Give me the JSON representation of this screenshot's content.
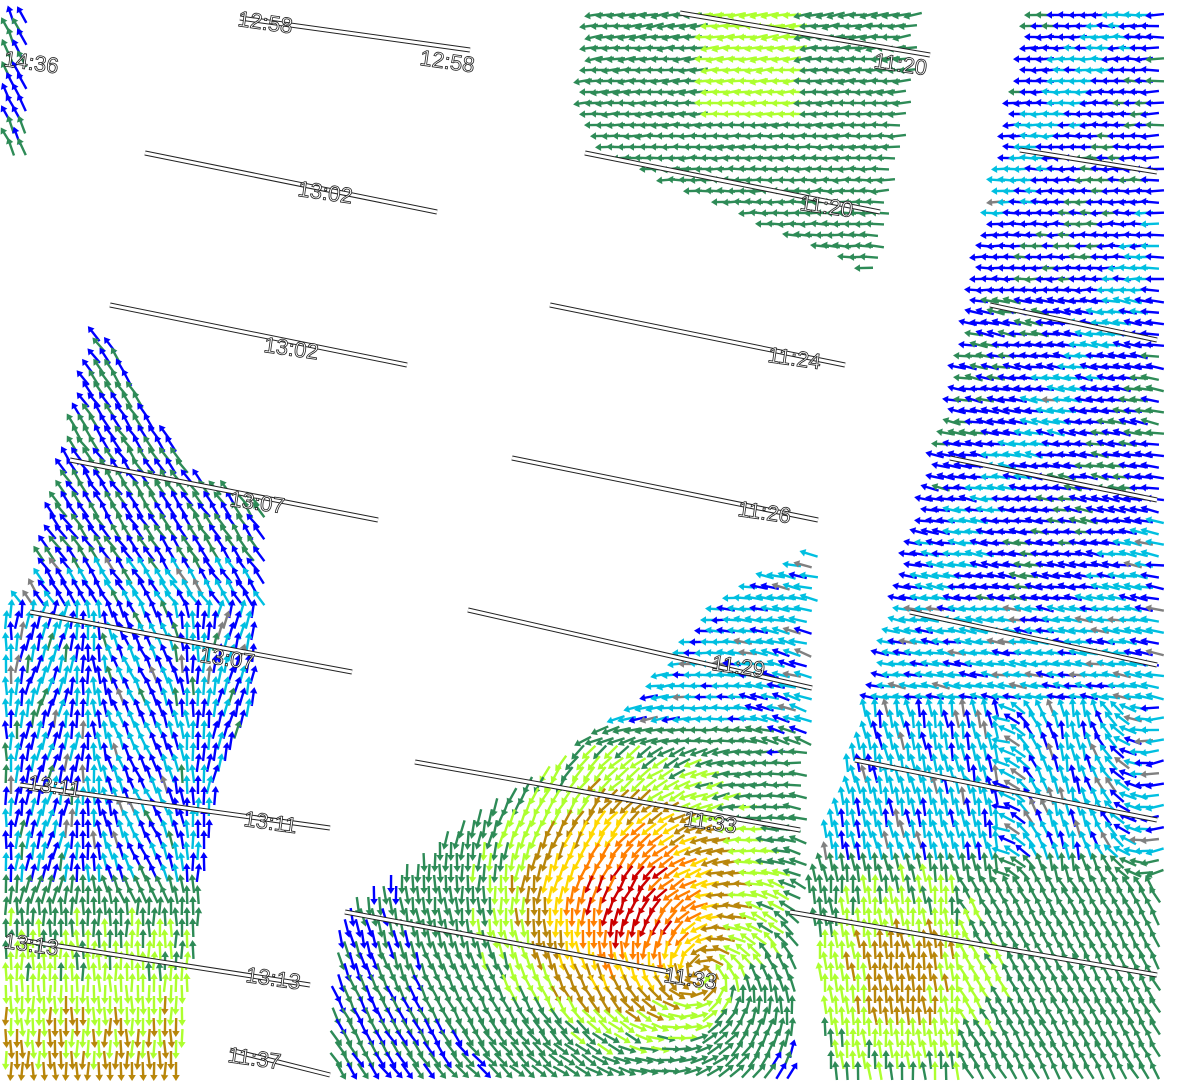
{
  "map": {
    "title": "Scatterometer wind vectors",
    "time_labels": [
      "14:36",
      "12:58",
      "12:58",
      "13:02",
      "13:02",
      "13:07",
      "13:07",
      "13:11",
      "13:11",
      "13:13",
      "13:13",
      "11:20",
      "11:20",
      "11:24",
      "11:26",
      "11:29",
      "11:33",
      "11:33",
      "11:37"
    ],
    "colors": {
      "blue": "#0000ff",
      "cyan": "#00bfe0",
      "green": "#2e8b57",
      "lime": "#adff2f",
      "olive": "#b8860b",
      "yellow": "#ffd700",
      "orange": "#ff7f00",
      "red": "#cc0000",
      "gray": "#808080"
    }
  }
}
